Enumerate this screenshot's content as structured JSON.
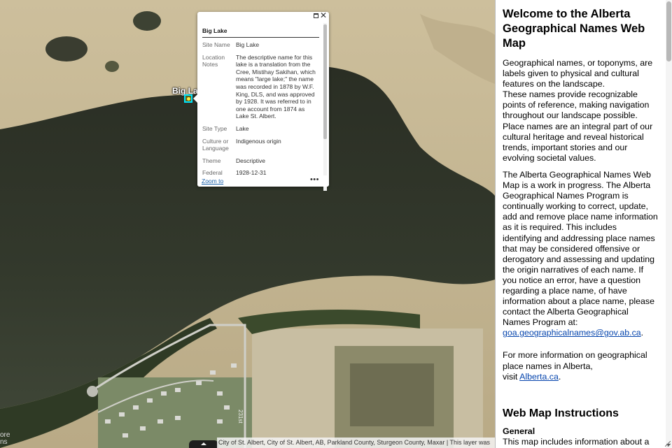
{
  "map": {
    "feature_label": "Big Lake",
    "corner_text": "ore\nns",
    "road_label": "231st",
    "attribution": "City of St. Albert, City of St. Albert, AB, Parkland County, Sturgeon County, Maxar | This layer was"
  },
  "popup": {
    "title": "Big Lake",
    "attributes": [
      {
        "key": "Site Name",
        "value": "Big Lake"
      },
      {
        "key": "Location Notes",
        "value": "The descriptive name for this lake is a translation from the Cree, Mistihay Sakihan, which means \"large lake;\" the name was recorded in 1878 by W.F. King, DLS, and was approved by 1928. It was referred to in one account from 1874 as Lake St. Albert."
      },
      {
        "key": "Site Type",
        "value": "Lake"
      },
      {
        "key": "Culture or Language",
        "value": "Indigenous origin"
      },
      {
        "key": "Theme",
        "value": "Descriptive"
      },
      {
        "key": "Federal Official",
        "value": "1928-12-31"
      }
    ],
    "zoom_label": "Zoom to",
    "more_label": "•••",
    "close_label": "✕"
  },
  "panel": {
    "title": "Welcome to the Alberta Geographical Names Web Map",
    "para1": "Geographical names, or toponyms, are labels given to physical and cultural features on the landscape.",
    "para2": "These names provide recognizable points of reference, making navigation throughout our landscape possible.",
    "para3": "Place names are an integral part of our cultural heritage and reveal historical trends, important stories and our evolving societal values.",
    "para4": "The Alberta Geographical Names Web Map is a work in progress. The Alberta Geographical Names Program is continually working to correct, update, add and remove place name information as it is required. This includes identifying and addressing place names that may be considered offensive or derogatory and assessing and updating the origin narratives of each name. If you notice an error, have a question regarding a place name, of have information about a place name, please contact the Alberta Geographical Names Program at:",
    "email": "goa.geographicalnames@gov.ab.ca",
    "para5": "For more information on geographical place names in Alberta,",
    "visit": "visit",
    "site_link": "Alberta.ca",
    "instructions_heading": "Web Map Instructions",
    "general_heading": "General",
    "general_text": "This map includes information about a"
  }
}
